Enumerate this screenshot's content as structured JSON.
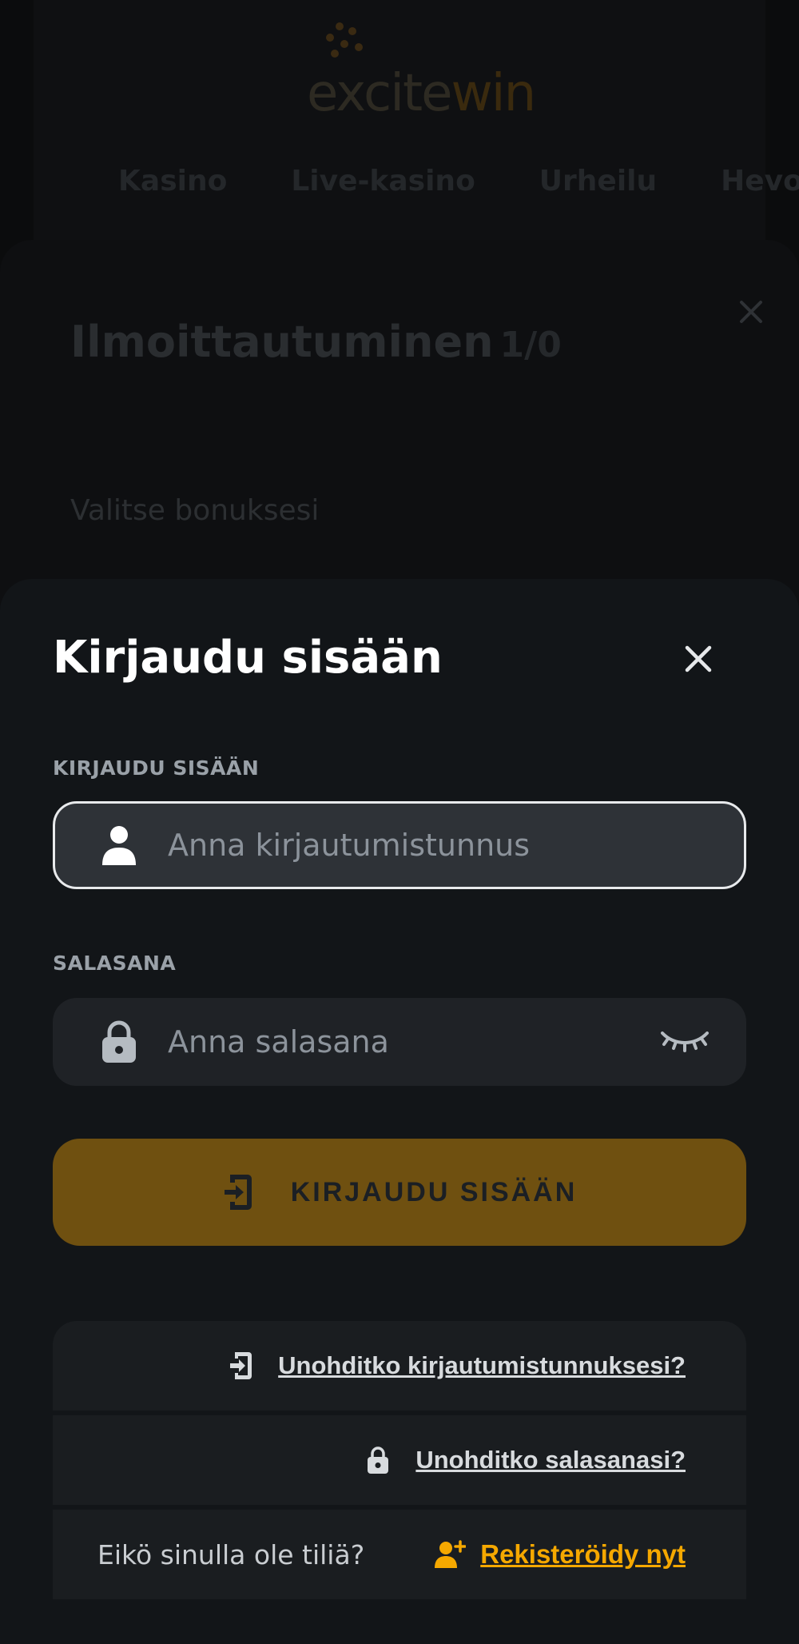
{
  "site": {
    "logo": {
      "text_a": "excite",
      "text_b": "win"
    },
    "nav": [
      "Kasino",
      "Live-kasino",
      "Urheilu",
      "Hevosurheilu"
    ]
  },
  "registration": {
    "title": "Ilmoittautuminen",
    "step": "1/0",
    "bonus_label": "Valitse bonuksesi"
  },
  "login": {
    "title": "Kirjaudu sisään",
    "username": {
      "label": "KIRJAUDU SISÄÄN",
      "placeholder": "Anna kirjautumistunnus",
      "value": ""
    },
    "password": {
      "label": "SALASANA",
      "placeholder": "Anna salasana",
      "value": ""
    },
    "submit_label": "KIRJAUDU SISÄÄN",
    "forgot_username": "Unohditko kirjautumistunnuksesi?",
    "forgot_password": "Unohditko salasanasi?",
    "no_account": "Eikö sinulla ole tiliä?",
    "register": "Rekisteröidy nyt"
  },
  "colors": {
    "modal_bg": "#121518",
    "button_bg": "#6f5010",
    "accent": "#f5a800",
    "input_focus_border": "#e8eaec"
  },
  "icons": {
    "modal_close": "close-icon",
    "username": "user-icon",
    "password": "lock-icon",
    "password_toggle": "eye-closed-icon",
    "submit": "login-icon",
    "forgot_username": "login-icon",
    "forgot_password": "lock-icon",
    "register": "add-user-icon"
  }
}
